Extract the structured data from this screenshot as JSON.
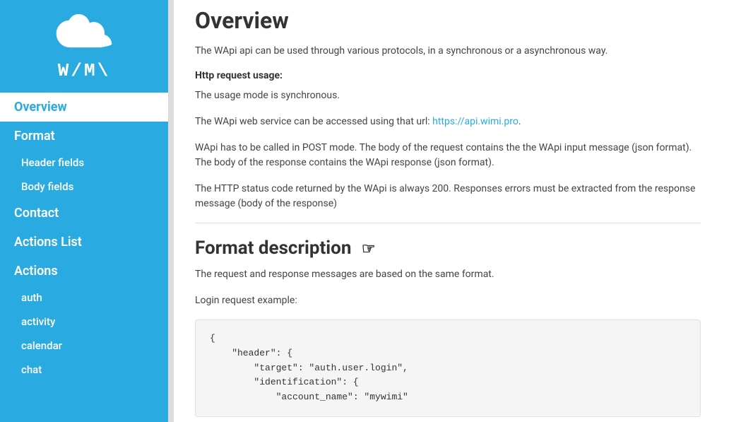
{
  "sidebar": {
    "logo_text": "W/M\\",
    "nav_items": [
      {
        "id": "overview",
        "label": "Overview",
        "active": true,
        "sub": false
      },
      {
        "id": "format",
        "label": "Format",
        "active": false,
        "sub": false
      },
      {
        "id": "header-fields",
        "label": "Header fields",
        "active": false,
        "sub": true
      },
      {
        "id": "body-fields",
        "label": "Body fields",
        "active": false,
        "sub": true
      },
      {
        "id": "contact",
        "label": "Contact",
        "active": false,
        "sub": false
      },
      {
        "id": "actions-list",
        "label": "Actions List",
        "active": false,
        "sub": false
      },
      {
        "id": "actions",
        "label": "Actions",
        "active": false,
        "sub": false
      },
      {
        "id": "auth",
        "label": "auth",
        "active": false,
        "sub": true
      },
      {
        "id": "activity",
        "label": "activity",
        "active": false,
        "sub": true
      },
      {
        "id": "calendar",
        "label": "calendar",
        "active": false,
        "sub": true
      },
      {
        "id": "chat",
        "label": "chat",
        "active": false,
        "sub": true
      }
    ]
  },
  "main": {
    "overview_title": "Overview",
    "overview_intro": "The WApi api can be used through various protocols, in a synchronous or a asynchronous way.",
    "http_request_label": "Http request usage:",
    "http_sync_text": "The usage mode is synchronous.",
    "wapi_url_pre": "The WApi web service can be accessed using that url: ",
    "wapi_url_link": "https://api.wimi.pro",
    "wapi_url_post": ".",
    "wapi_post_text": "WApi has to be called in POST mode. The body of the request contains the the WApi input message (json format). The body of the response contains the WApi response (json format).",
    "wapi_http_text": "The HTTP status code returned by the WApi is always 200. Responses errors must be extracted from the response message (body of the response)",
    "format_title": "Format description",
    "format_intro": "The request and response messages are based on the same format.",
    "login_label": "Login request example:",
    "code_example": "{\n    \"header\": {\n        \"target\": \"auth.user.login\",\n        \"identification\": {\n            \"account_name\": \"mywimi\""
  }
}
